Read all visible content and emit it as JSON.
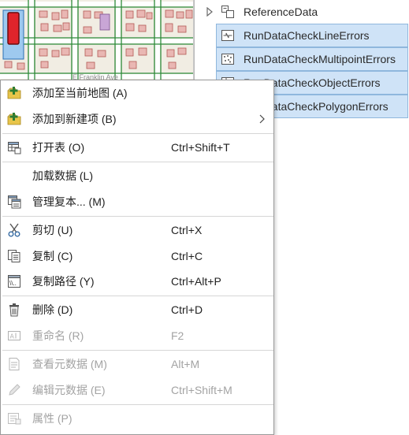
{
  "tree": {
    "items": [
      {
        "label": "ReferenceData",
        "icon": "feature-dataset-icon",
        "selected": false
      },
      {
        "label": "RunDataCheckLineErrors",
        "icon": "line-feature-class-icon",
        "selected": true
      },
      {
        "label": "RunDataCheckMultipointErrors",
        "icon": "multipoint-feature-class-icon",
        "selected": true
      },
      {
        "label": "RunDataCheckObjectErrors",
        "icon": "table-icon",
        "selected": true
      },
      {
        "label": "RunDataCheckPolygonErrors",
        "icon": "polygon-feature-class-icon",
        "selected": true
      }
    ]
  },
  "map": {
    "street_label": "E Franklin Ave"
  },
  "menu": {
    "items": [
      {
        "label": "添加至当前地图 (A)",
        "shortcut": "",
        "icon": "add-to-map-icon",
        "enabled": true
      },
      {
        "label": "添加到新建项 (B)",
        "shortcut": "",
        "icon": "add-to-new-icon",
        "enabled": true,
        "submenu": true
      },
      {
        "label": "打开表 (O)",
        "shortcut": "Ctrl+Shift+T",
        "icon": "open-table-icon",
        "enabled": true
      },
      {
        "label": "加载数据 (L)",
        "shortcut": "",
        "icon": "",
        "enabled": true
      },
      {
        "label": "管理复本... (M)",
        "shortcut": "",
        "icon": "manage-replicas-icon",
        "enabled": true
      },
      {
        "label": "剪切 (U)",
        "shortcut": "Ctrl+X",
        "icon": "cut-icon",
        "enabled": true
      },
      {
        "label": "复制 (C)",
        "shortcut": "Ctrl+C",
        "icon": "copy-icon",
        "enabled": true
      },
      {
        "label": "复制路径 (Y)",
        "shortcut": "Ctrl+Alt+P",
        "icon": "copy-path-icon",
        "enabled": true
      },
      {
        "label": "删除 (D)",
        "shortcut": "Ctrl+D",
        "icon": "delete-icon",
        "enabled": true
      },
      {
        "label": "重命名 (R)",
        "shortcut": "F2",
        "icon": "rename-icon",
        "enabled": false
      },
      {
        "label": "查看元数据 (M)",
        "shortcut": "Alt+M",
        "icon": "view-metadata-icon",
        "enabled": false
      },
      {
        "label": "编辑元数据 (E)",
        "shortcut": "Ctrl+Shift+M",
        "icon": "edit-metadata-icon",
        "enabled": false
      },
      {
        "label": "属性 (P)",
        "shortcut": "",
        "icon": "properties-icon",
        "enabled": false
      }
    ]
  },
  "colors": {
    "selection": "#cfe3f7",
    "selection_border": "#8fb7dd",
    "disabled_text": "#a3a3a3"
  }
}
